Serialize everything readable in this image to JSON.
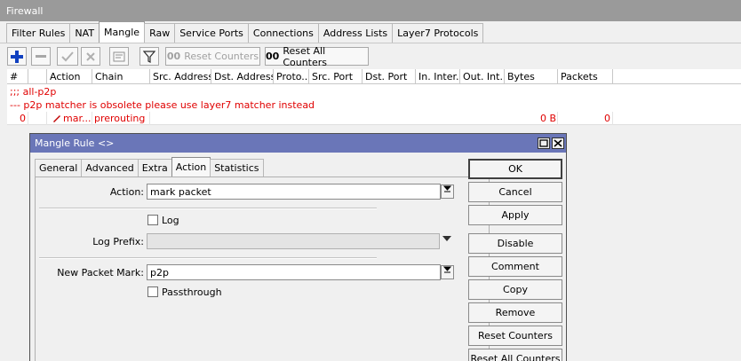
{
  "firewall": {
    "title": "Firewall",
    "tabs": [
      "Filter Rules",
      "NAT",
      "Mangle",
      "Raw",
      "Service Ports",
      "Connections",
      "Address Lists",
      "Layer7 Protocols"
    ],
    "active_tab": "Mangle",
    "toolbar": {
      "filter_icon": "filter-icon",
      "reset_counters_label": "Reset Counters",
      "reset_counters_prefix": "00",
      "reset_all_counters_label": "Reset All Counters",
      "reset_all_counters_prefix": "00"
    },
    "table": {
      "columns": [
        "#",
        "",
        "Action",
        "Chain",
        "Src. Address",
        "Dst. Address",
        "Proto...",
        "Src. Port",
        "Dst. Port",
        "In. Inter...",
        "Out. Int...",
        "Bytes",
        "Packets"
      ],
      "comment1": ";;; all-p2p",
      "comment2": "--- p2p matcher is obsolete please use layer7 matcher instead",
      "row": {
        "num": "0",
        "action": "mar...",
        "chain": "prerouting",
        "bytes": "0 B",
        "packets": "0"
      }
    }
  },
  "dialog": {
    "title": "Mangle Rule <>",
    "tabs": [
      "General",
      "Advanced",
      "Extra",
      "Action",
      "Statistics"
    ],
    "active_tab": "Action",
    "fields": {
      "action_label": "Action:",
      "action_value": "mark packet",
      "log_label": "Log",
      "log_checked": false,
      "log_prefix_label": "Log Prefix:",
      "log_prefix_value": "",
      "new_packet_mark_label": "New Packet Mark:",
      "new_packet_mark_value": "p2p",
      "passthrough_label": "Passthrough",
      "passthrough_checked": false
    },
    "buttons": {
      "ok": "OK",
      "cancel": "Cancel",
      "apply": "Apply",
      "disable": "Disable",
      "comment": "Comment",
      "copy": "Copy",
      "remove": "Remove",
      "reset_counters": "Reset Counters",
      "reset_all_counters": "Reset All Counters"
    }
  },
  "colors": {
    "accent_blue": "#1040c0",
    "rule_red": "#e00000",
    "dialog_titlebar": "#6a76b8"
  }
}
